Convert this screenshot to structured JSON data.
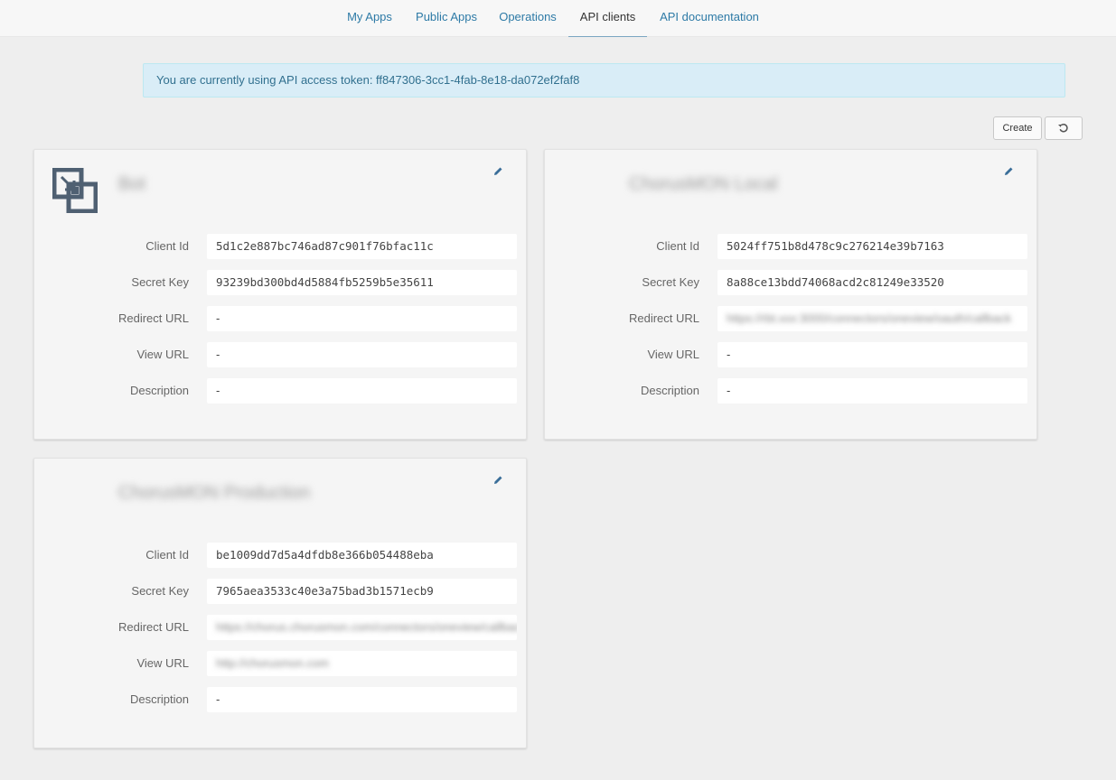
{
  "nav": {
    "tabs": [
      {
        "label": "My Apps",
        "active": false
      },
      {
        "label": "Public Apps",
        "active": false
      },
      {
        "label": "Operations",
        "active": false
      },
      {
        "label": "API clients",
        "active": true
      },
      {
        "label": "API documentation",
        "active": false
      }
    ]
  },
  "banner": {
    "text": "You are currently using API access token: ff847306-3cc1-4fab-8e18-da072ef2faf8"
  },
  "toolbar": {
    "create_label": "Create",
    "refresh_icon": "refresh-icon"
  },
  "labels": {
    "client_id": "Client Id",
    "secret_key": "Secret Key",
    "redirect_url": "Redirect URL",
    "view_url": "View URL",
    "description": "Description"
  },
  "clients": [
    {
      "name": "Bot",
      "client_id": "5d1c2e887bc746ad87c901f76bfac11c",
      "secret_key": "93239bd300bd4d5884fb5259b5e35611",
      "redirect_url": "-",
      "view_url": "-",
      "description": "-"
    },
    {
      "name": "ChorusMON Local",
      "client_id": "5024ff751b8d478c9c276214e39b7163",
      "secret_key": "8a88ce13bdd74068acd2c81249e33520",
      "redirect_url": "https://rbt.xxx:3000/connectors/oneview/oauth/callback",
      "view_url": "-",
      "description": "-"
    },
    {
      "name": "ChorusMON Production",
      "client_id": "be1009dd7d5a4dfdb8e366b054488eba",
      "secret_key": "7965aea3533c40e3a75bad3b1571ecb9",
      "redirect_url": "https://chorus.chorusmon.com/connectors/oneview/callback",
      "view_url": "http://chorusmon.com",
      "description": "-"
    }
  ]
}
